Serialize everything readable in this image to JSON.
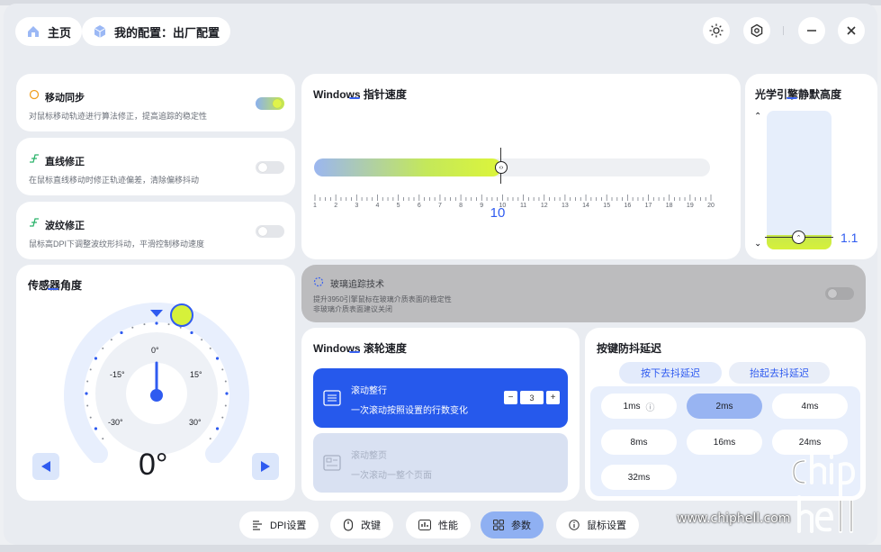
{
  "header": {
    "home_label": "主页",
    "config_label": "我的配置：出厂配置"
  },
  "toggles": [
    {
      "title": "移动同步",
      "desc": "对鼠标移动轨迹进行算法修正，提高追踪的稳定性",
      "on": true
    },
    {
      "title": "直线修正",
      "desc": "在鼠标直线移动时修正轨迹偏差，清除偏移抖动",
      "on": false
    },
    {
      "title": "波纹修正",
      "desc": "鼠标高DPI下调整波纹形抖动，平滑控制移动速度",
      "on": false
    }
  ],
  "pointer_speed": {
    "title": "Windows 指针速度",
    "value": "10",
    "ticks": [
      "1",
      "2",
      "3",
      "4",
      "5",
      "6",
      "7",
      "8",
      "9",
      "10",
      "11",
      "12",
      "13",
      "14",
      "15",
      "16",
      "17",
      "18",
      "19",
      "20"
    ]
  },
  "lod": {
    "title": "光学引擎静默高度",
    "value": "1.1"
  },
  "sensor": {
    "title": "传感器角度",
    "labels": {
      "zero": "0°",
      "neg15": "-15°",
      "pos15": "15°",
      "neg30": "-30°",
      "pos30": "30°"
    },
    "value": "0°"
  },
  "glass": {
    "title": "玻璃追踪技术",
    "desc1": "提升3950引擎鼠标在玻璃介质表面的稳定性",
    "desc2": "非玻璃介质表面建议关闭"
  },
  "scroll": {
    "title": "Windows 滚轮速度",
    "opt1_title": "滚动整行",
    "opt1_desc": "一次滚动按照设置的行数变化",
    "opt1_value": "3",
    "opt2_title": "滚动整页",
    "opt2_desc": "一次滚动一整个页面"
  },
  "debounce": {
    "title": "按键防抖延迟",
    "tab_press": "按下去抖延迟",
    "tab_release": "抬起去抖延迟",
    "options": [
      "1ms",
      "2ms",
      "4ms",
      "8ms",
      "16ms",
      "24ms",
      "32ms"
    ],
    "selected": "2ms"
  },
  "nav": {
    "dpi": "DPI设置",
    "keys": "改键",
    "perf": "性能",
    "params": "参数",
    "mouse": "鼠标设置"
  },
  "watermark": {
    "url": "www.chiphell.com",
    "logo": "chip hell"
  },
  "colors": {
    "accent": "#2f5bf0",
    "lime": "#d6f13a",
    "active_nav": "#8fb0f2"
  }
}
